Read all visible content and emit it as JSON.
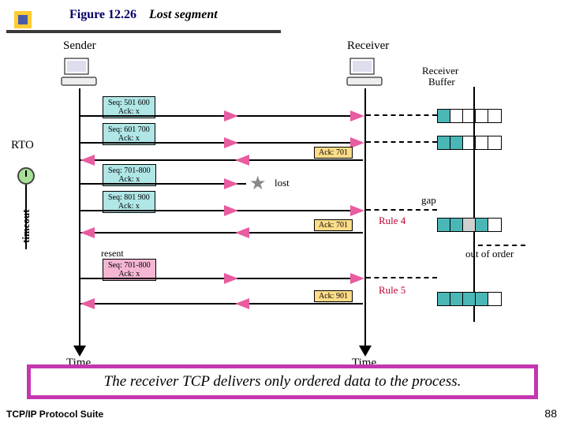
{
  "figure": {
    "number": "Figure 12.26",
    "title": "Lost segment"
  },
  "sender_label": "Sender",
  "receiver_label": "Receiver",
  "buffer_label1": "Receiver",
  "buffer_label2": "Buffer",
  "rto": "RTO",
  "timeout_word": "timeout",
  "lost_word": "lost",
  "gap_word": "gap",
  "ooo_word": "out of order",
  "resent_word": "resent",
  "time_word": "Time",
  "rule4": "Rule 4",
  "rule5": "Rule 5",
  "segs": [
    {
      "line1": "Seq: 501 600",
      "line2": "Ack: x"
    },
    {
      "line1": "Seq: 601 700",
      "line2": "Ack: x"
    },
    {
      "line1": "Seq: 701-800",
      "line2": "Ack: x"
    },
    {
      "line1": "Seq: 801 900",
      "line2": "Ack: x"
    },
    {
      "line1": "Seq: 701-800",
      "line2": "Ack: x"
    }
  ],
  "acks": [
    {
      "text": "Ack: 701"
    },
    {
      "text": "Ack: 701"
    },
    {
      "text": "Ack: 901"
    }
  ],
  "caption": "The receiver TCP delivers only ordered data to the process.",
  "footer_left": "TCP/IP Protocol Suite",
  "page_number": "88"
}
